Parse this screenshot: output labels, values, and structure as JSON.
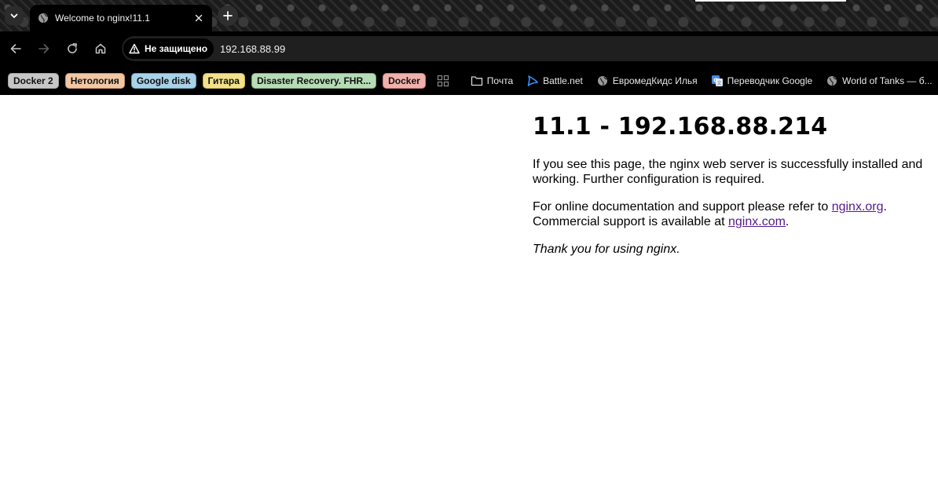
{
  "tab": {
    "title": "Welcome to nginx!11.1"
  },
  "toolbar": {
    "security_label": "Не защищено",
    "url": "192.168.88.99"
  },
  "bookmarks": {
    "groups": [
      {
        "label": "Docker 2",
        "bg": "#c7c7c7",
        "border": "#a4a4a4"
      },
      {
        "label": "Нетология",
        "bg": "#f2c7a3",
        "border": "#c79068"
      },
      {
        "label": "Google disk",
        "bg": "#a8d2e8",
        "border": "#6c9fb7"
      },
      {
        "label": "Гитара",
        "bg": "#f2e08a",
        "border": "#c3ae4c"
      },
      {
        "label": "Disaster Recovery. FHR...",
        "bg": "#b6dcb6",
        "border": "#7ea77e"
      },
      {
        "label": "Docker",
        "bg": "#f0b1ac",
        "border": "#c47c76"
      }
    ],
    "links": [
      {
        "label": "Почта",
        "icon": "folder-icon"
      },
      {
        "label": "Battle.net",
        "icon": "battlenet-icon"
      },
      {
        "label": "ЕвромедКидс Илья",
        "icon": "globe-icon"
      },
      {
        "label": "Переводчик Google",
        "icon": "google-translate-icon"
      },
      {
        "label": "World of Tanks — б...",
        "icon": "globe-icon"
      }
    ]
  },
  "page": {
    "heading": "11.1 - 192.168.88.214",
    "p1": "If you see this page, the nginx web server is successfully installed and working. Further configuration is required.",
    "p2_before": "For online documentation and support please refer to ",
    "p2_link1": "nginx.org",
    "p2_mid": ".",
    "p2_line2": "Commercial support is available at ",
    "p2_link2": "nginx.com",
    "p2_end": ".",
    "p3": "Thank you for using nginx."
  },
  "colors": {
    "link": "#551a8b",
    "chrome_bg": "#000000"
  }
}
